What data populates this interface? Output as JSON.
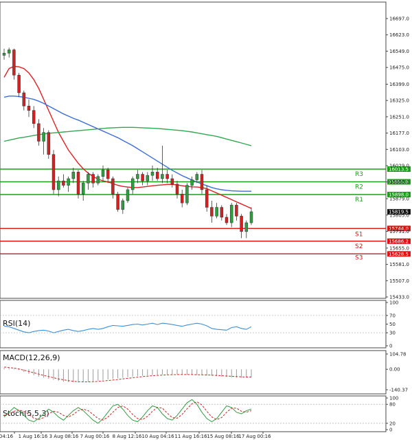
{
  "chart_data": [
    {
      "type": "candlestick",
      "title": "",
      "price_axis_ticks": [
        16697.0,
        16623.0,
        16549.0,
        16475.0,
        16399.0,
        16325.0,
        16251.0,
        16177.0,
        16103.0,
        16029.0,
        15955.0,
        15879.0,
        15805.0,
        15731.0,
        15655.0,
        15581.0,
        15507.0,
        15433.0
      ],
      "time_axis_labels": [
        "04:16",
        "1 Aug 16:16",
        "3 Aug 08:16",
        "7 Aug 00:16",
        "8 Aug 12:16",
        "10 Aug 04:16",
        "11 Aug 16:16",
        "15 Aug 08:16",
        "17 Aug 00:16"
      ],
      "current_price": "15819.5",
      "resistance": [
        {
          "label": "R3",
          "value": 16013.5,
          "text": "16013.5",
          "color": "#1a9e1a"
        },
        {
          "label": "R2",
          "value": 15955.8,
          "text": "15955.8",
          "color": "#1a9e1a"
        },
        {
          "label": "R1",
          "value": 15898.0,
          "text": "15898.0",
          "color": "#1a9e1a"
        }
      ],
      "support": [
        {
          "label": "S1",
          "value": 15744.0,
          "text": "15744.0",
          "color": "#e01010"
        },
        {
          "label": "S2",
          "value": 15686.2,
          "text": "15686.2",
          "color": "#e01010"
        },
        {
          "label": "S3",
          "value": 15628.5,
          "text": "15628.5",
          "color": "#e01010"
        }
      ],
      "candles": [
        [
          16530,
          16560,
          16510,
          16540
        ],
        [
          16540,
          16565,
          16520,
          16555
        ],
        [
          16555,
          16560,
          16420,
          16440
        ],
        [
          16440,
          16450,
          16340,
          16360
        ],
        [
          16360,
          16370,
          16280,
          16300
        ],
        [
          16300,
          16330,
          16250,
          16280
        ],
        [
          16280,
          16300,
          16200,
          16220
        ],
        [
          16220,
          16240,
          16120,
          16140
        ],
        [
          16140,
          16200,
          16080,
          16180
        ],
        [
          16180,
          16190,
          16060,
          16080
        ],
        [
          16080,
          16100,
          15900,
          15920
        ],
        [
          15920,
          15980,
          15890,
          15960
        ],
        [
          15960,
          15990,
          15930,
          15940
        ],
        [
          15940,
          15980,
          15910,
          15970
        ],
        [
          15970,
          16020,
          15950,
          16000
        ],
        [
          16000,
          16010,
          15880,
          15900
        ],
        [
          15900,
          15960,
          15870,
          15950
        ],
        [
          15950,
          16000,
          15920,
          15990
        ],
        [
          15990,
          16000,
          15930,
          15950
        ],
        [
          15950,
          15990,
          15940,
          15980
        ],
        [
          15980,
          16030,
          15960,
          16010
        ],
        [
          16010,
          16020,
          15950,
          15970
        ],
        [
          15970,
          15980,
          15880,
          15900
        ],
        [
          15900,
          15910,
          15820,
          15830
        ],
        [
          15830,
          15880,
          15810,
          15870
        ],
        [
          15870,
          15930,
          15860,
          15920
        ],
        [
          15920,
          15980,
          15900,
          15970
        ],
        [
          15970,
          16010,
          15950,
          15990
        ],
        [
          15990,
          16000,
          15940,
          15960
        ],
        [
          15960,
          16000,
          15940,
          15985
        ],
        [
          15985,
          16030,
          15960,
          16000
        ],
        [
          16000,
          16020,
          15960,
          15970
        ],
        [
          15970,
          16120,
          15950,
          15990
        ],
        [
          15990,
          16010,
          15950,
          15970
        ],
        [
          15970,
          15990,
          15930,
          15945
        ],
        [
          15945,
          15960,
          15880,
          15900
        ],
        [
          15900,
          15920,
          15840,
          15860
        ],
        [
          15860,
          15950,
          15850,
          15940
        ],
        [
          15940,
          15980,
          15920,
          15965
        ],
        [
          15965,
          16000,
          15950,
          15990
        ],
        [
          15990,
          16010,
          15900,
          15920
        ],
        [
          15920,
          15940,
          15820,
          15840
        ],
        [
          15840,
          15870,
          15770,
          15800
        ],
        [
          15800,
          15860,
          15790,
          15840
        ],
        [
          15840,
          15850,
          15780,
          15795
        ],
        [
          15795,
          15810,
          15760,
          15770
        ],
        [
          15770,
          15860,
          15750,
          15850
        ],
        [
          15850,
          15860,
          15780,
          15800
        ],
        [
          15800,
          15810,
          15700,
          15730
        ],
        [
          15730,
          15780,
          15700,
          15770
        ],
        [
          15770,
          15840,
          15760,
          15820
        ]
      ],
      "moving_averages": [
        {
          "name": "",
          "color": "#e02020",
          "values": [
            16430,
            16470,
            16480,
            16478,
            16470,
            16450,
            16420,
            16380,
            16330,
            16280,
            16230,
            16180,
            16140,
            16100,
            16070,
            16040,
            16015,
            15995,
            15980,
            15968,
            15960,
            15955,
            15948,
            15940,
            15935,
            15932,
            15930,
            15930,
            15932,
            15935,
            15938,
            15940,
            15942,
            15944,
            15944,
            15942,
            15938,
            15935,
            15933,
            15932,
            15930,
            15925,
            15915,
            15905,
            15895,
            15885,
            15875,
            15865,
            15855,
            15845,
            15835
          ]
        },
        {
          "name": "",
          "color": "#3a6fd8",
          "values": [
            16340,
            16345,
            16345,
            16343,
            16340,
            16335,
            16330,
            16322,
            16312,
            16300,
            16288,
            16276,
            16264,
            16254,
            16244,
            16236,
            16226,
            16216,
            16206,
            16196,
            16186,
            16176,
            16166,
            16156,
            16144,
            16132,
            16120,
            16106,
            16092,
            16078,
            16064,
            16050,
            16036,
            16022,
            16008,
            15996,
            15984,
            15974,
            15964,
            15955,
            15946,
            15938,
            15930,
            15924,
            15920,
            15917,
            15915,
            15914,
            15913,
            15913,
            15913
          ]
        },
        {
          "name": "",
          "color": "#2fa84f",
          "values": [
            16140,
            16145,
            16150,
            16155,
            16158,
            16162,
            16166,
            16170,
            16173,
            16176,
            16178,
            16180,
            16182,
            16184,
            16186,
            16188,
            16190,
            16192,
            16194,
            16196,
            16198,
            16200,
            16201,
            16202,
            16203,
            16203,
            16203,
            16202,
            16201,
            16200,
            16199,
            16198,
            16196,
            16194,
            16192,
            16190,
            16188,
            16185,
            16182,
            16178,
            16174,
            16170,
            16166,
            16162,
            16156,
            16150,
            16144,
            16138,
            16132,
            16126,
            16120
          ]
        }
      ]
    },
    {
      "type": "line",
      "name": "RSI(14)",
      "ticks": [
        100,
        70,
        50,
        30,
        0
      ],
      "ylim": [
        0,
        100
      ],
      "values": [
        45,
        44,
        40,
        36,
        32,
        30,
        33,
        35,
        36,
        34,
        30,
        33,
        36,
        38,
        35,
        33,
        35,
        38,
        40,
        38,
        40,
        44,
        47,
        46,
        45,
        47,
        49,
        50,
        48,
        50,
        52,
        49,
        52,
        51,
        49,
        47,
        45,
        48,
        50,
        52,
        50,
        46,
        40,
        38,
        37,
        36,
        42,
        44,
        40,
        38,
        44
      ]
    },
    {
      "type": "bar",
      "name": "MACD(12,26,9)",
      "ticks": [
        104.78,
        0.0,
        -140.37
      ],
      "ylim": [
        -140.37,
        104.78
      ],
      "histogram": [
        10,
        8,
        5,
        -5,
        -18,
        -30,
        -40,
        -50,
        -58,
        -65,
        -72,
        -80,
        -85,
        -88,
        -90,
        -90,
        -88,
        -85,
        -82,
        -78,
        -74,
        -70,
        -66,
        -62,
        -58,
        -54,
        -50,
        -46,
        -44,
        -42,
        -40,
        -38,
        -36,
        -35,
        -35,
        -35,
        -36,
        -37,
        -38,
        -39,
        -40,
        -42,
        -44,
        -47,
        -50,
        -53,
        -55,
        -57,
        -58,
        -56,
        -52
      ],
      "signal": [
        15,
        12,
        8,
        2,
        -6,
        -15,
        -24,
        -33,
        -42,
        -50,
        -58,
        -66,
        -72,
        -78,
        -82,
        -85,
        -86,
        -86,
        -85,
        -83,
        -80,
        -77,
        -74,
        -70,
        -66,
        -62,
        -58,
        -54,
        -50,
        -47,
        -44,
        -42,
        -40,
        -38,
        -37,
        -36,
        -36,
        -36,
        -36,
        -37,
        -38,
        -39,
        -40,
        -42,
        -44,
        -46,
        -48,
        -50,
        -52,
        -53,
        -53
      ]
    },
    {
      "type": "line",
      "name": "Stoch(5,5,3)",
      "ticks": [
        100,
        80,
        20,
        0
      ],
      "ylim": [
        0,
        100
      ],
      "k": [
        40,
        55,
        70,
        60,
        45,
        30,
        25,
        35,
        50,
        65,
        55,
        40,
        30,
        45,
        60,
        70,
        60,
        45,
        30,
        20,
        35,
        55,
        75,
        80,
        65,
        45,
        30,
        25,
        40,
        60,
        75,
        70,
        50,
        35,
        30,
        45,
        65,
        85,
        95,
        80,
        55,
        35,
        25,
        35,
        55,
        75,
        70,
        55,
        50,
        60,
        65
      ],
      "d": [
        45,
        50,
        58,
        62,
        58,
        48,
        36,
        32,
        38,
        50,
        58,
        55,
        45,
        40,
        48,
        60,
        65,
        60,
        48,
        35,
        30,
        40,
        55,
        70,
        75,
        65,
        48,
        35,
        32,
        42,
        58,
        70,
        68,
        52,
        38,
        36,
        48,
        66,
        82,
        88,
        78,
        58,
        40,
        32,
        38,
        55,
        68,
        68,
        58,
        55,
        60
      ]
    }
  ]
}
